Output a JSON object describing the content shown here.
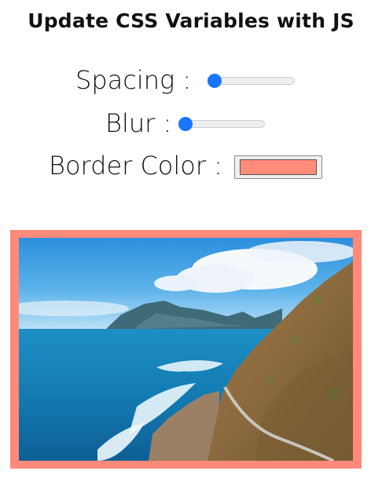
{
  "header": {
    "title": "Update CSS Variables with JS"
  },
  "controls": {
    "spacing": {
      "label": "Spacing :",
      "value": 0
    },
    "blur": {
      "label": "Blur :",
      "value": 0
    },
    "border_color": {
      "label": "Border Color :",
      "value": "#ff8c7a"
    }
  },
  "image": {
    "icon": "coastal-landscape-photo"
  },
  "colors": {
    "accent": "#1a74ff",
    "frame": "#ff8a7a"
  }
}
